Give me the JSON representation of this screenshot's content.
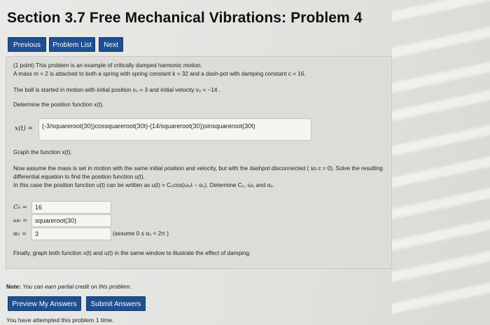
{
  "page": {
    "title": "Section 3.7 Free Mechanical Vibrations: Problem 4"
  },
  "nav": {
    "previous": "Previous",
    "problem_list": "Problem List",
    "next": "Next"
  },
  "problem": {
    "intro": "(1 point) This problem is an example of critically damped harmonic motion.",
    "line_mass": "A mass m = 2 is attached to both a spring with spring constant k = 32 and a dash-pot with damping constant c = 16.",
    "line_initial": "The ball is started in motion with initial position x₀ = 3 and initial velocity v₀ = −14 .",
    "determine": "Determine the position function x(t).",
    "x_label": "x(t) =",
    "x_answer": "(-3/squareroot(30))cossquareroot(30t)-(14/squareroot(30))sinsquareroot(30t)",
    "graph": "Graph the function x(t).",
    "assume_line1": "Now assume the mass is set in motion with the same initial position and velocity, but with the dashpot disconnected ( so c = 0). Solve the resulting",
    "assume_line2": "differential equation to find the position function u(t).",
    "assume_line3": "In this case the position function u(t) can be written as u(t) = C₀cos(ω₀t − α₀). Determine C₀, ω₀ and α₀.",
    "c0_label": "C₀ =",
    "c0_value": "16",
    "w0_label": "ω₀ =",
    "w0_value": "squareroot(30)",
    "a0_label": "α₀ =",
    "a0_value": "3",
    "a0_hint": "(assume 0 ≤ α₀ < 2π )",
    "finally": "Finally, graph both function x(t) and u(t) in the same window to illustrate the effect of damping."
  },
  "footer": {
    "note_bold": "Note:",
    "note_text": "You can earn partial credit on this problem.",
    "preview_button": "Preview My Answers",
    "submit_button": "Submit Answers",
    "attempts": "You have attempted this problem 1 time."
  },
  "colors": {
    "button_bg": "#1e4f91",
    "panel_bg": "#dcdcd8"
  }
}
